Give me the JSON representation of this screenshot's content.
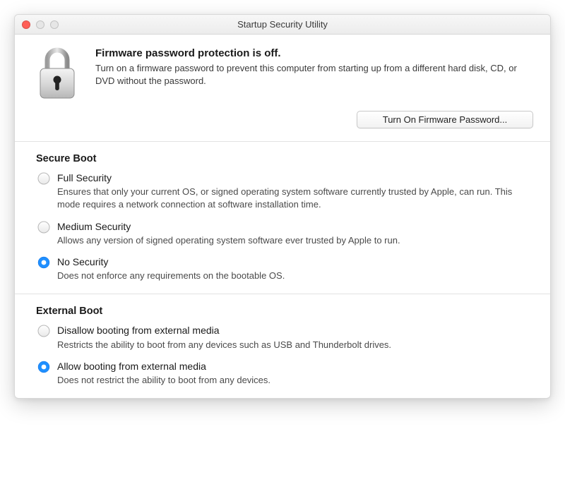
{
  "window": {
    "title": "Startup Security Utility"
  },
  "header": {
    "title": "Firmware password protection is off.",
    "description": "Turn on a firmware password to prevent this computer from starting up from a different hard disk, CD, or DVD without the password.",
    "button_label": "Turn On Firmware Password..."
  },
  "secure_boot": {
    "title": "Secure Boot",
    "options": [
      {
        "label": "Full Security",
        "desc": "Ensures that only your current OS, or signed operating system software currently trusted by Apple, can run. This mode requires a network connection at software installation time.",
        "selected": false
      },
      {
        "label": "Medium Security",
        "desc": "Allows any version of signed operating system software ever trusted by Apple to run.",
        "selected": false
      },
      {
        "label": "No Security",
        "desc": "Does not enforce any requirements on the bootable OS.",
        "selected": true
      }
    ]
  },
  "external_boot": {
    "title": "External Boot",
    "options": [
      {
        "label": "Disallow booting from external media",
        "desc": "Restricts the ability to boot from any devices such as USB and Thunderbolt drives.",
        "selected": false
      },
      {
        "label": "Allow booting from external media",
        "desc": "Does not restrict the ability to boot from any devices.",
        "selected": true
      }
    ]
  }
}
